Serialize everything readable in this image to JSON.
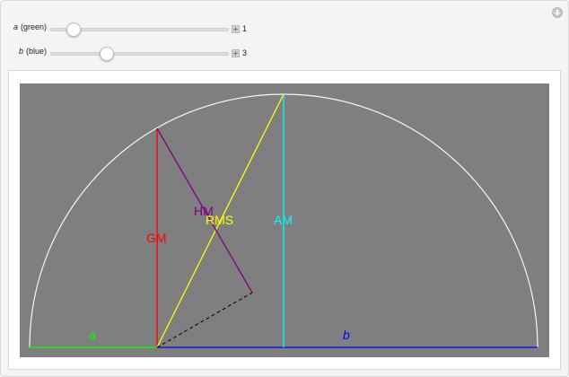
{
  "controls": {
    "a": {
      "name": "a",
      "suffix": "(green)",
      "value": "1",
      "fraction": 0.133
    },
    "b": {
      "name": "b",
      "suffix": "(blue)",
      "value": "3",
      "fraction": 0.315
    }
  },
  "diagram": {
    "labels": {
      "gm": "GM",
      "hm": "HM",
      "rms": "RMS",
      "am": "AM",
      "a": "a",
      "b": "b"
    },
    "colors": {
      "background": "#7f7f7f",
      "circle": "#e8ffe8",
      "gm": "#ff0000",
      "hm": "#800080",
      "rms": "#ffff00",
      "am": "#00ffff",
      "a_segment": "#00ff00",
      "b_segment": "#0000ff",
      "dashed": "#000000"
    }
  },
  "icons": {
    "corner": "plus-circle-icon",
    "increment": "plus-square-icon"
  }
}
